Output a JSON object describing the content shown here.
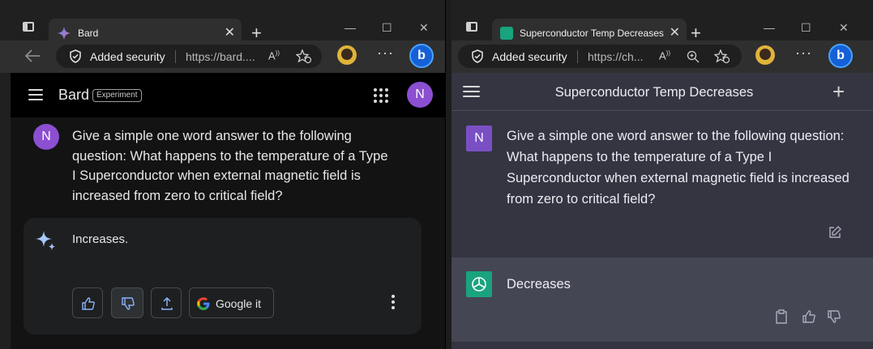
{
  "left_window": {
    "tab_title": "Bard",
    "security_label": "Added security",
    "url": "https://bard....",
    "page": {
      "app_title": "Bard",
      "badge": "Experiment",
      "user_initial": "N",
      "question": "Give a simple one word answer to the following question: What happens to the temperature of a Type I Superconductor when external magnetic field is increased from zero to critical field?",
      "answer": "Increases.",
      "google_it_label": "Google it"
    }
  },
  "right_window": {
    "tab_title": "Superconductor Temp Decreases",
    "security_label": "Added security",
    "url": "https://ch...",
    "page": {
      "conversation_title": "Superconductor Temp Decreases",
      "user_initial": "N",
      "question": "Give a simple one word answer to the following question: What happens to the temperature of a Type I Superconductor when external magnetic field is increased from zero to critical field?",
      "answer": "Decreases"
    }
  },
  "colors": {
    "bard_bg": "#131314",
    "bard_card": "#1e1f20",
    "bard_avatar": "#8c4fd1",
    "gpt_bg": "#343541",
    "gpt_answer_bg": "#444654",
    "gpt_logo": "#19a37f",
    "edge_profile_button": "#1560d6"
  }
}
